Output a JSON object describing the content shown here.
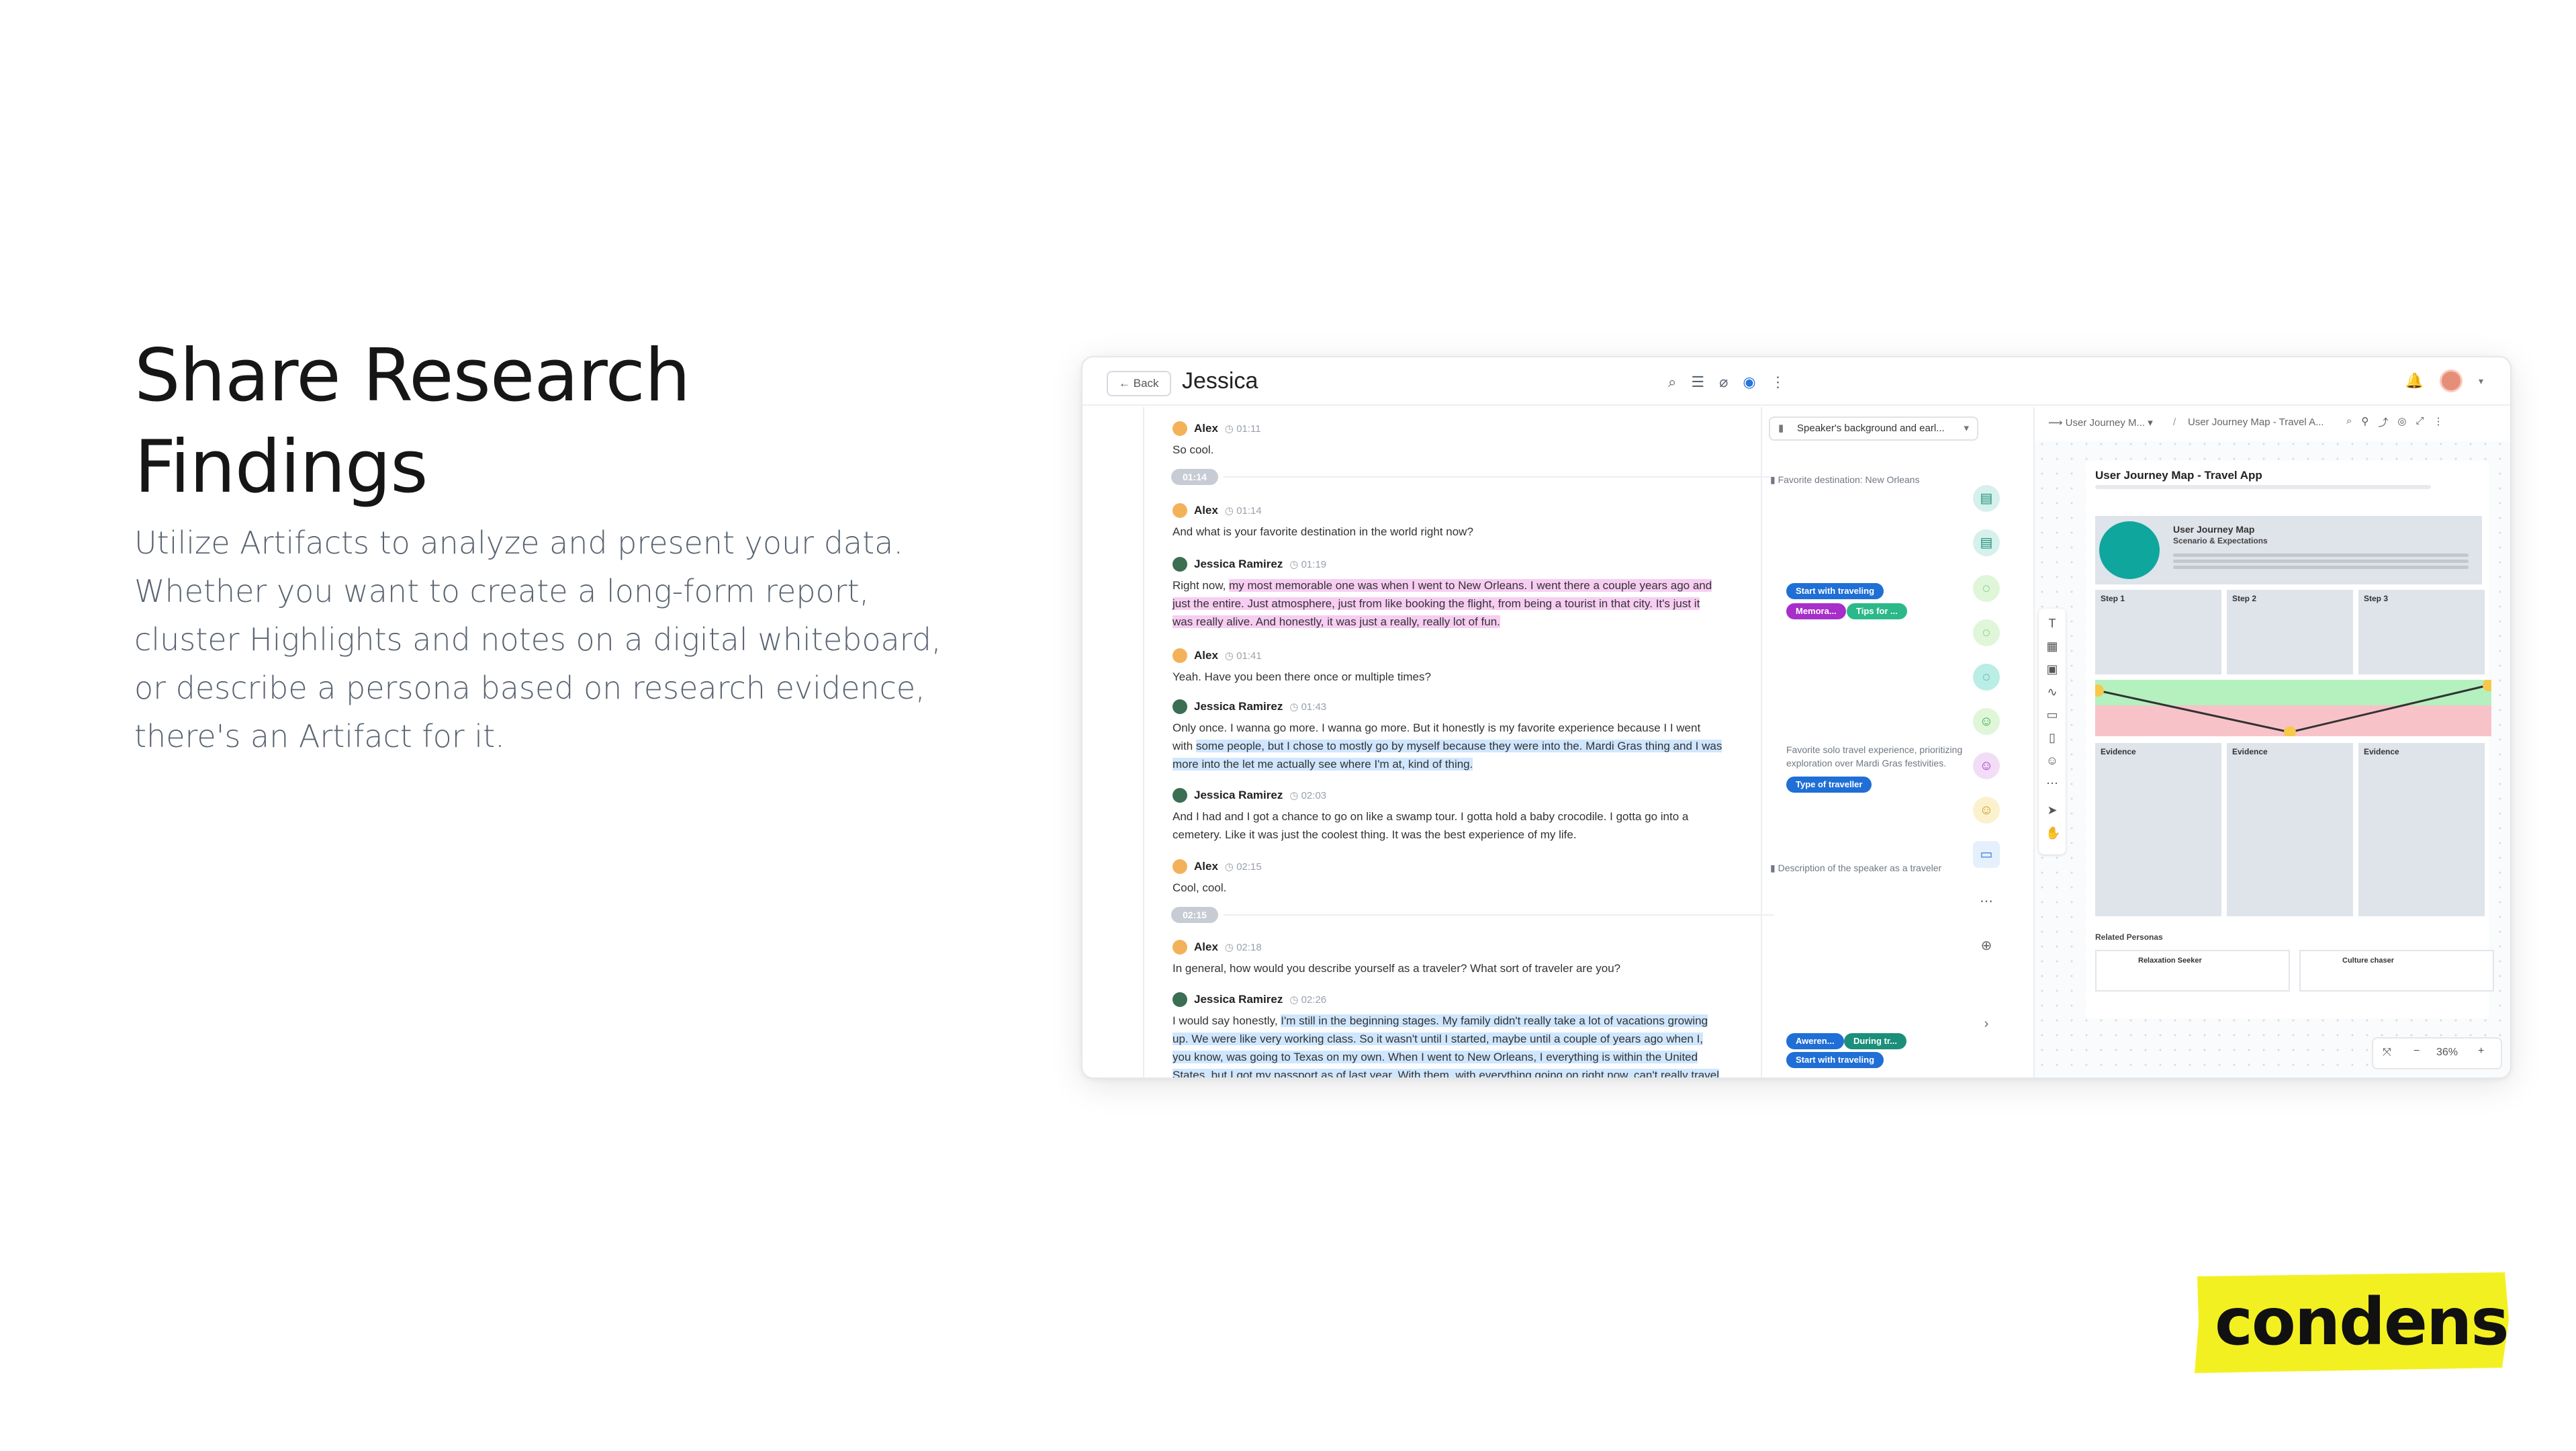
{
  "hero": {
    "title_line1": "Share Research",
    "title_line2": "Findings",
    "description": "Utilize Artifacts to analyze and present your data. Whether you want to create a long-form report, cluster Highlights and notes on a digital whiteboard, or describe a persona based on research evidence, there's an Artifact for it."
  },
  "brand": {
    "logo_text": "condens",
    "accent": "#f3f022"
  },
  "app": {
    "back_label": "Back",
    "title": "Jessica",
    "topbar_icons": [
      "search-icon",
      "list-icon",
      "attachment-icon",
      "check-circle-icon",
      "more-vertical-icon"
    ],
    "topbar_right_icons": [
      "bell-icon",
      "avatar",
      "chevron-down-icon"
    ]
  },
  "transcript": {
    "messages": [
      {
        "speaker": "Alex",
        "time": "01:11",
        "text": "So cool."
      },
      {
        "speaker": "Alex",
        "time": "01:14",
        "text": "And what is your favorite destination in the world right now?"
      },
      {
        "speaker": "Jessica Ramirez",
        "time": "01:19",
        "pre": "Right now, ",
        "hl1": "my most memorable one was when I went to New Orleans. I went there a couple years ago and just the entire. Just atmosphere, just from like booking the flight, from being a tourist in that city. It's just it was really alive. And honestly, it was just a really, really lot of fun."
      },
      {
        "speaker": "Alex",
        "time": "01:41",
        "text": "Yeah. Have you been there once or multiple times?"
      },
      {
        "speaker": "Jessica Ramirez",
        "time": "01:43",
        "pre": "Only once. I wanna go more. I wanna go more. But it honestly is my favorite experience because I I went with ",
        "hl1": "some people, but I chose to mostly go by myself because they were into the. Mardi Gras thing and I was more into the let me actually see where I'm at, kind of thing."
      },
      {
        "speaker": "Jessica Ramirez",
        "time": "02:03",
        "text": " And I had and I got a chance to go on like a swamp tour. I gotta hold a baby crocodile. I gotta go into a cemetery. Like it was just the coolest thing. It was the best experience of my life."
      },
      {
        "speaker": "Alex",
        "time": "02:15",
        "text": "Cool, cool."
      },
      {
        "speaker": "Alex",
        "time": "02:18",
        "text": "In general, how would you describe yourself as a traveler? What sort of traveler are you?"
      },
      {
        "speaker": "Jessica Ramirez",
        "time": "02:26",
        "pre": "I would say honestly, ",
        "hl1": "I'm still in the beginning stages. My family didn't really take a lot of vacations growing up. We were like very working class. So it wasn't until I started, maybe until a couple of years ago when I, you know, was going to Texas on my own. When I went to New Orleans, I everything is within the United States, but I got my passport as of last year. With them, with everything going on right now, can't really travel right"
      }
    ],
    "time_markers": [
      "01:14",
      "02:15"
    ]
  },
  "tags_panel": {
    "dropdown_label": "Speaker's background and earl...",
    "sections": [
      "Favorite destination: New Orleans",
      "Favorite solo travel experience, prioritizing exploration over Mardi Gras festivities.",
      "Description of the speaker as a traveler"
    ],
    "tags": [
      "Start with traveling",
      "Memora...",
      "Tips for ...",
      "Type of traveller",
      "Aweren...",
      "During tr...",
      "Start with traveling"
    ]
  },
  "canvas": {
    "breadcrumb1": "User Journey M...",
    "breadcrumb2": "User Journey Map - Travel A...",
    "board_title": "User Journey Map - Travel App",
    "persona_title": "User Journey Map",
    "persona_subtitle": "Scenario & Expectations",
    "steps": [
      "Step 1",
      "Step 2",
      "Step 3"
    ],
    "evidence_label": "Evidence",
    "related_title": "Related Personas",
    "related": [
      "Relaxation Seeker",
      "Culture chaser"
    ],
    "zoom": "36%"
  }
}
